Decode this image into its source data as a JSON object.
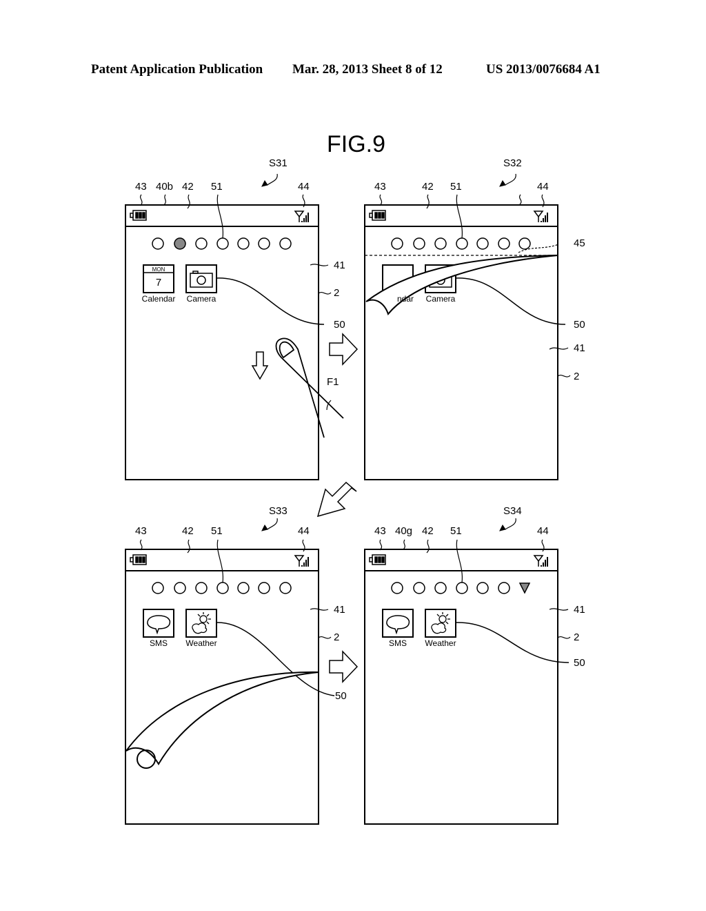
{
  "header": {
    "left": "Patent Application Publication",
    "center": "Mar. 28, 2013  Sheet 8 of 12",
    "right": "US 2013/0076684 A1"
  },
  "figure": {
    "title": "FIG.9",
    "panels": [
      {
        "id": "S31",
        "ref_labels": {
          "battery": "43",
          "status_bar_ref": "40b",
          "status_bar": "42",
          "page_indicator": "51",
          "signal": "44",
          "screen": "41",
          "display": "2",
          "icon_ref": "50",
          "finger": "F1"
        },
        "active_indicator_index": 1,
        "indicator_count": 7,
        "icons": [
          {
            "name": "Calendar",
            "glyph": "calendar",
            "day": "MON",
            "date": "7"
          },
          {
            "name": "Camera",
            "glyph": "camera"
          }
        ],
        "gesture": "swipe-down"
      },
      {
        "id": "S32",
        "ref_labels": {
          "battery": "43",
          "status_bar": "42",
          "page_indicator": "51",
          "signal": "44",
          "fold_line": "45",
          "icon_ref": "50",
          "screen": "41",
          "display": "2"
        },
        "active_indicator_index": -1,
        "indicator_count": 7,
        "icons": [
          {
            "name": "Calendar",
            "partial_label": "ndar",
            "glyph": "calendar"
          },
          {
            "name": "Camera",
            "glyph": "camera"
          }
        ],
        "effect": "page-peel"
      },
      {
        "id": "S33",
        "ref_labels": {
          "battery": "43",
          "status_bar": "42",
          "page_indicator": "51",
          "signal": "44",
          "screen": "41",
          "display": "2",
          "icon_ref": "50"
        },
        "active_indicator_index": -1,
        "indicator_count": 7,
        "icons": [
          {
            "name": "SMS",
            "glyph": "speech-bubble"
          },
          {
            "name": "Weather",
            "glyph": "sun-cloud"
          }
        ],
        "effect": "page-roll"
      },
      {
        "id": "S34",
        "ref_labels": {
          "battery": "43",
          "status_bar_ref": "40g",
          "status_bar": "42",
          "page_indicator": "51",
          "signal": "44",
          "screen": "41",
          "display": "2",
          "icon_ref": "50"
        },
        "active_indicator_index": 6,
        "active_indicator_shape": "triangle",
        "indicator_count": 7,
        "icons": [
          {
            "name": "SMS",
            "glyph": "speech-bubble"
          },
          {
            "name": "Weather",
            "glyph": "sun-cloud"
          }
        ]
      }
    ]
  }
}
